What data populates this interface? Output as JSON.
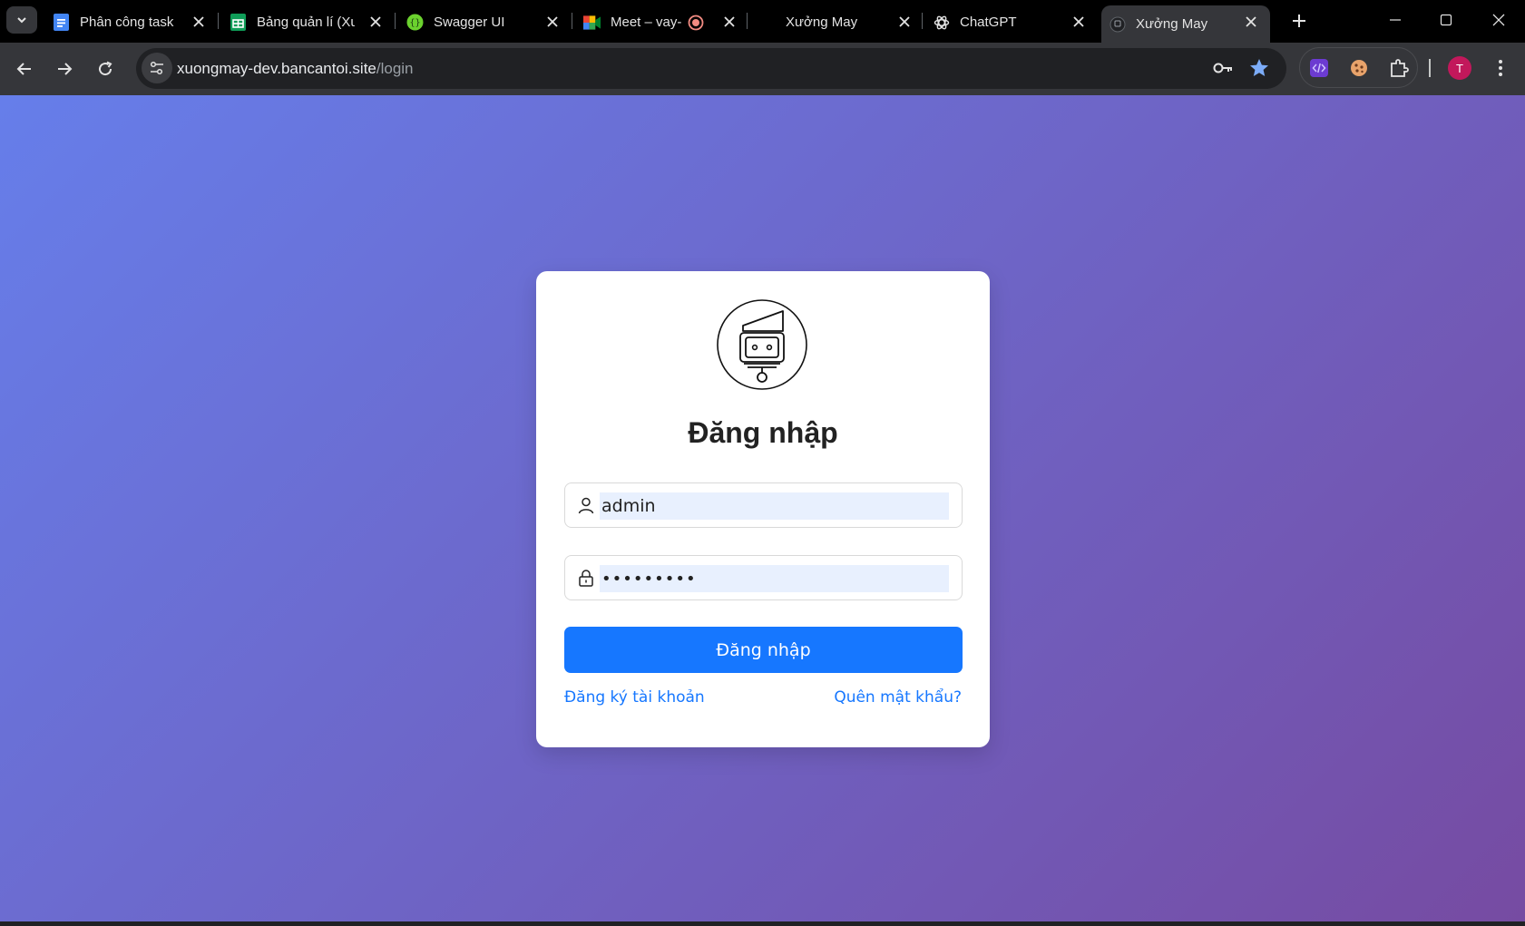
{
  "browser": {
    "tabs": [
      {
        "title": "Phân công task",
        "icon": "google-docs-icon"
      },
      {
        "title": "Bảng quản lí (Xư",
        "icon": "google-sheets-icon"
      },
      {
        "title": "Swagger UI",
        "icon": "swagger-icon"
      },
      {
        "title": "Meet – vay-",
        "icon": "google-meet-icon",
        "recording": true
      },
      {
        "title": "Xưởng May",
        "icon": "none"
      },
      {
        "title": "ChatGPT",
        "icon": "openai-icon"
      },
      {
        "title": "Xưởng May",
        "icon": "site-logo-icon",
        "active": true
      }
    ],
    "url_host": "xuongmay-dev.bancantoi.site",
    "url_path": "/login",
    "profile_initial": "T",
    "colors": {
      "profile": "#c2185b",
      "star": "#7cacf8"
    }
  },
  "login": {
    "title": "Đăng nhập",
    "username_value": "admin",
    "password_value": "•••••••••",
    "submit_label": "Đăng nhập",
    "register_link": "Đăng ký tài khoản",
    "forgot_link": "Quên mật khẩu?",
    "colors": {
      "primary": "#1677ff",
      "gradient_start": "#667eea",
      "gradient_end": "#764ba2"
    }
  }
}
